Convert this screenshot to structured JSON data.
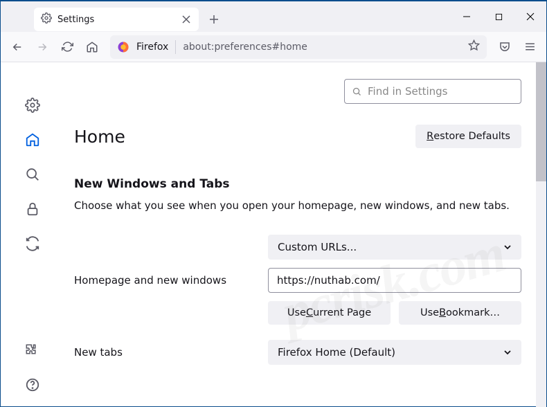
{
  "tab": {
    "title": "Settings"
  },
  "urlbar": {
    "label": "Firefox",
    "url": "about:preferences#home"
  },
  "search": {
    "placeholder": "Find in Settings"
  },
  "page": {
    "heading": "Home",
    "restore_label": "Restore Defaults",
    "restore_ak": "R",
    "section_title": "New Windows and Tabs",
    "section_desc": "Choose what you see when you open your homepage, new windows, and new tabs."
  },
  "homepage": {
    "label": "Homepage and new windows",
    "select_value": "Custom URLs...",
    "url_value": "https://nuthab.com/",
    "use_current": "Use Current Page",
    "use_current_ak": "C",
    "use_bookmark": "Use Bookmark…",
    "use_bookmark_ak": "B"
  },
  "newtabs": {
    "label": "New tabs",
    "select_value": "Firefox Home (Default)"
  },
  "watermark": "pcrisk.com"
}
